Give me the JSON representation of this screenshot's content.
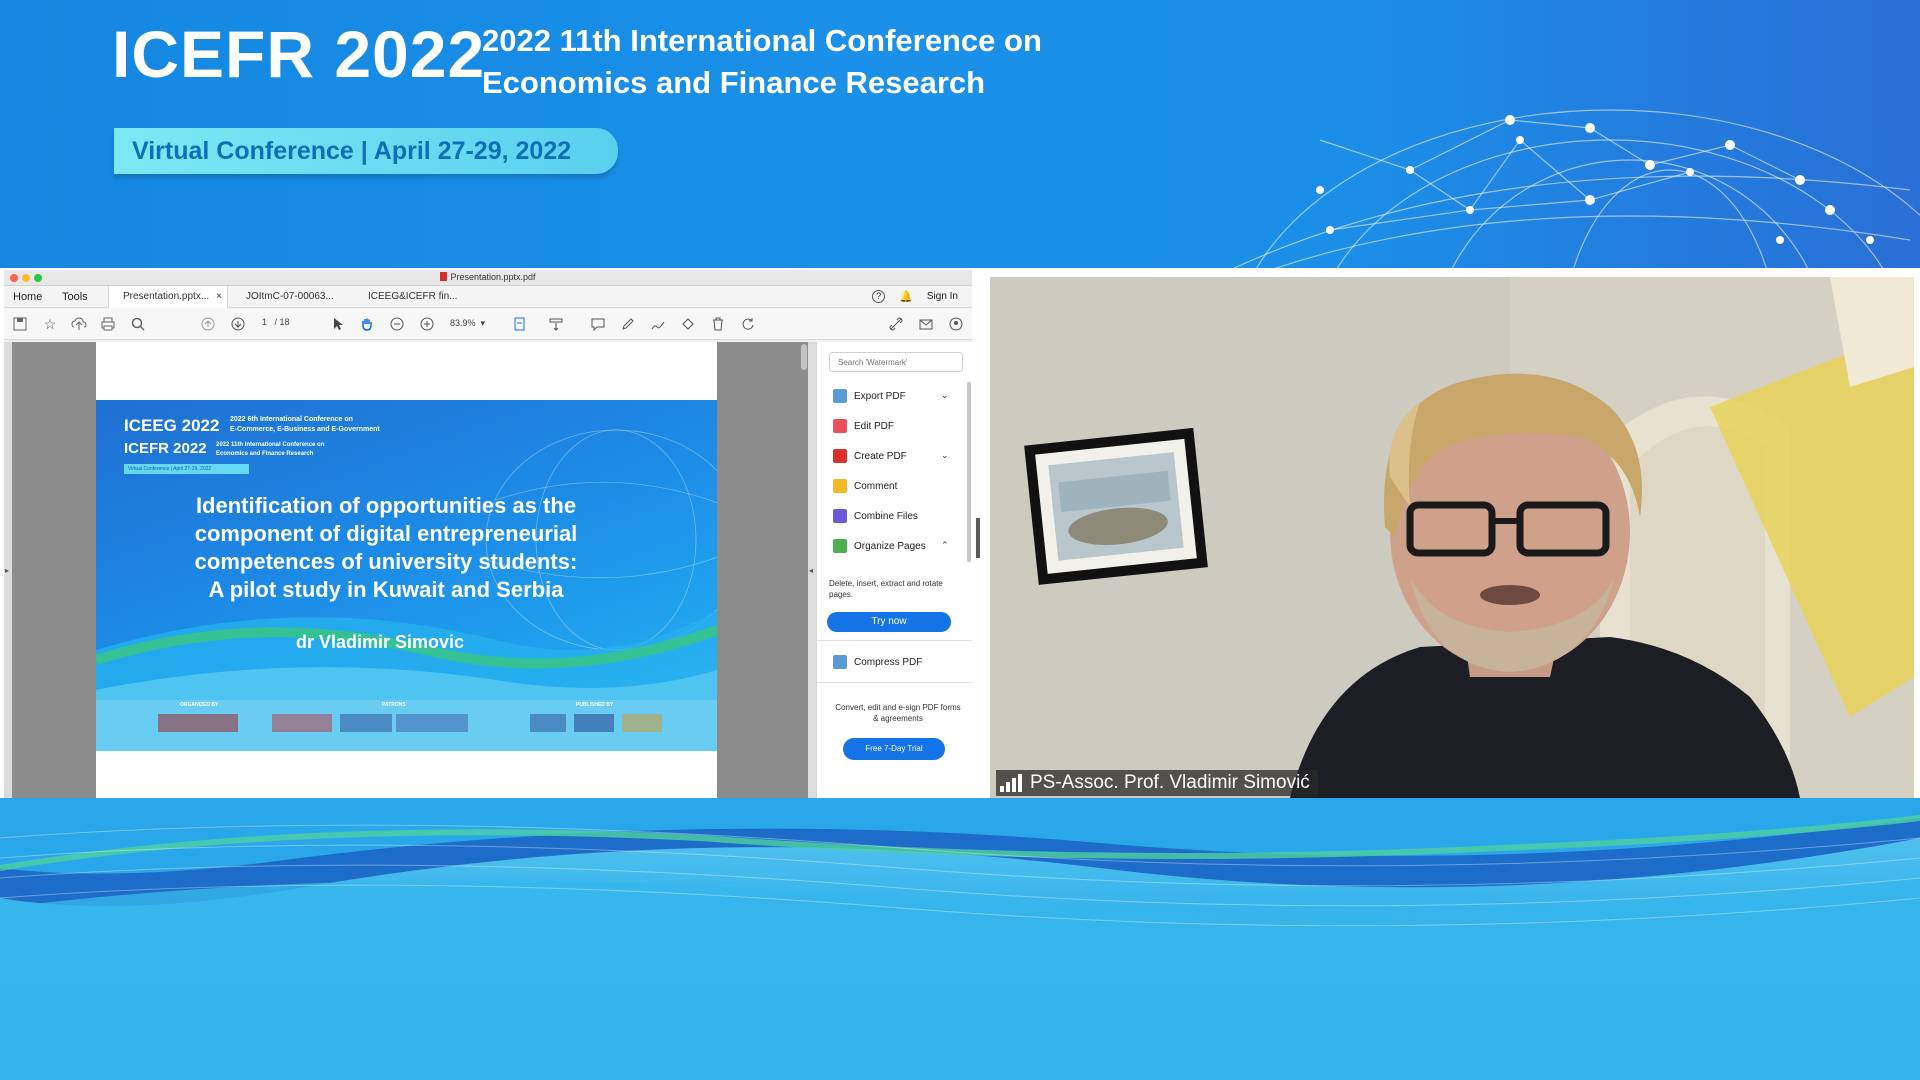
{
  "banner": {
    "title": "ICEFR 2022",
    "subtitle_line1": "2022 11th International Conference on",
    "subtitle_line2": "Economics and Finance Research",
    "badge": "Virtual Conference | April 27-29, 2022"
  },
  "pdf_window": {
    "window_title": "Presentation.pptx.pdf",
    "menu": {
      "home": "Home",
      "tools": "Tools"
    },
    "tabs": [
      {
        "label": "Presentation.pptx...",
        "active": true
      },
      {
        "label": "JOItmC-07-00063...",
        "active": false
      },
      {
        "label": "ICEEG&ICEFR fin...",
        "active": false
      }
    ],
    "tab_close": "×",
    "help": "?",
    "sign_in": "Sign In",
    "page_current": "1",
    "page_total": "/ 18",
    "zoom": "83.9%",
    "slide": {
      "logo1": "ICEEG 2022",
      "logo1_sub_line1": "2022 6th International Conference on",
      "logo1_sub_line2": "E-Commerce, E-Business and E-Government",
      "logo2": "ICEFR 2022",
      "logo2_sub_line1": "2022 11th International Conference on",
      "logo2_sub_line2": "Economics and Finance Research",
      "badge": "Virtual Conference | April 27-29, 2022",
      "title_line1": "Identification of opportunities as the",
      "title_line2": "component of digital entrepreneurial",
      "title_line3": "competences of university students:",
      "title_line4": "A pilot study in Kuwait and Serbia",
      "author": "dr Vladimir Simovic",
      "organized_by": "ORGANIZED BY",
      "patrons": "PATRONS",
      "published_by": "PUBLISHED BY"
    },
    "side_pane": {
      "search_placeholder": "Search 'Watermark'",
      "items": [
        {
          "label": "Export PDF",
          "chevron": "⌄"
        },
        {
          "label": "Edit PDF"
        },
        {
          "label": "Create PDF",
          "chevron": "⌄"
        },
        {
          "label": "Comment"
        },
        {
          "label": "Combine Files"
        },
        {
          "label": "Organize Pages",
          "chevron": "⌃"
        }
      ],
      "organize_desc": "Delete, insert, extract and rotate pages.",
      "try_now": "Try now",
      "compress": "Compress PDF",
      "promo": "Convert, edit and e-sign PDF forms & agreements",
      "trial": "Free 7-Day Trial"
    }
  },
  "video": {
    "participant_name": "PS-Assoc. Prof. Vladimir Simović"
  },
  "colors": {
    "banner_blue": "#1a8fe6",
    "badge_cyan": "#6ee3f3",
    "acrobat_blue": "#1473e6",
    "traffic_red": "#fe5f57",
    "traffic_yellow": "#febc2e",
    "traffic_green": "#28c840"
  },
  "icons": [
    "save-icon",
    "star-icon",
    "upload-icon",
    "print-icon",
    "zoom-search-icon",
    "page-up-icon",
    "page-down-icon",
    "cursor-icon",
    "hand-icon",
    "zoom-out-icon",
    "zoom-in-icon",
    "fit-page-icon",
    "scroll-icon",
    "comment-icon",
    "pen-icon",
    "sign-icon",
    "stamp-icon",
    "trash-icon",
    "rotate-icon",
    "link-icon",
    "mail-icon",
    "account-icon",
    "help-icon",
    "bell-icon",
    "signal-bars-icon"
  ]
}
